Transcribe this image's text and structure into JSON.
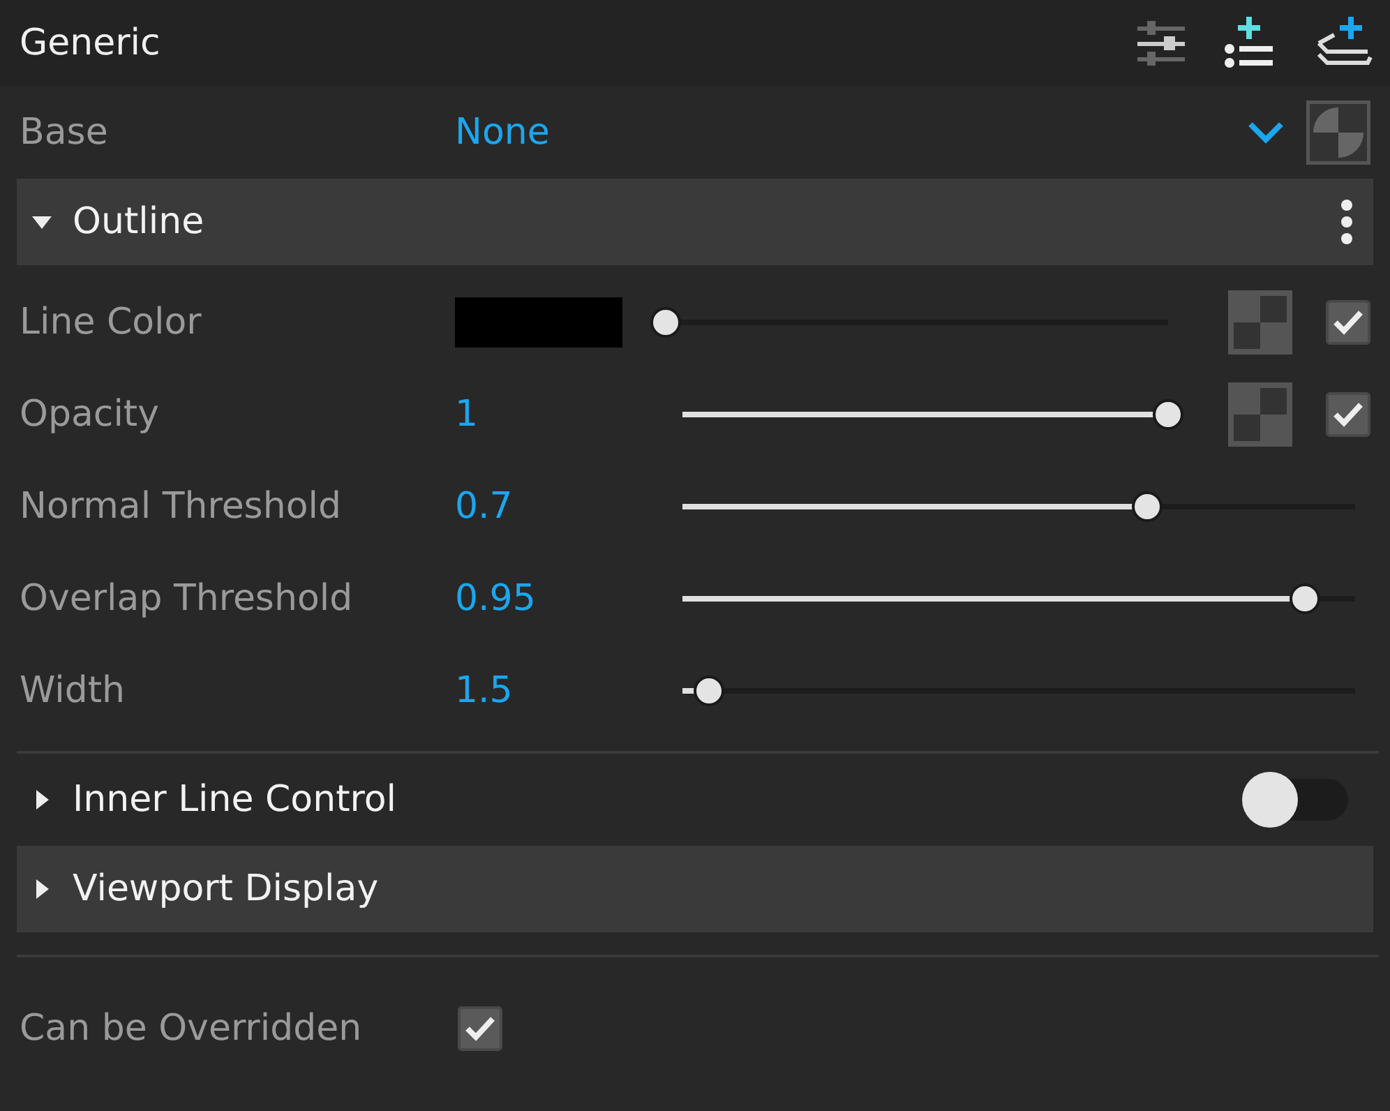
{
  "header": {
    "title": "Generic"
  },
  "base": {
    "label": "Base",
    "value": "None"
  },
  "outline": {
    "title": "Outline",
    "expanded": true,
    "properties": [
      {
        "kind": "color",
        "label": "Line Color",
        "color": "#000000",
        "level": 0,
        "animated": true,
        "checked": true
      },
      {
        "kind": "slider",
        "label": "Opacity",
        "value": "1",
        "level": 1,
        "animated": true,
        "checked": true
      },
      {
        "kind": "slider",
        "label": "Normal Threshold",
        "value": "0.7",
        "level": 0.69
      },
      {
        "kind": "slider",
        "label": "Overlap Threshold",
        "value": "0.95",
        "level": 0.925
      },
      {
        "kind": "slider",
        "label": "Width",
        "value": "1.5",
        "level": 0.04
      }
    ]
  },
  "sections": [
    {
      "title": "Inner Line Control",
      "expanded": false,
      "shaded": false,
      "on": false
    },
    {
      "title": "Viewport Display",
      "expanded": false,
      "shaded": true
    }
  ],
  "override": {
    "label": "Can be Overridden",
    "checked": true
  }
}
